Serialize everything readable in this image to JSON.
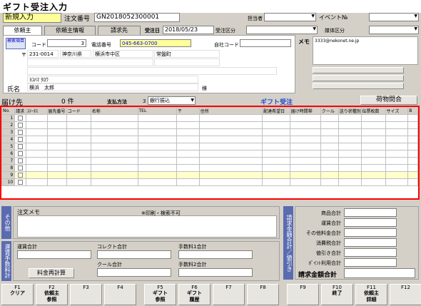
{
  "window": {
    "title": "ギフト受注入力"
  },
  "header": {
    "mode": "新規入力",
    "order_no_label": "注文番号",
    "order_no": "GN2018052300001",
    "staff_label": "担当者",
    "event_label": "イベント№"
  },
  "tabs": [
    "依頼主",
    "依頼主情報",
    "請求先"
  ],
  "order_date_label": "受注日",
  "order_date": "2018/05/23",
  "order_type_label": "受注区分",
  "medium_label": "媒体区分",
  "client": {
    "search_label": "検索項目",
    "code_label": "コード",
    "code": "3",
    "phone_label": "電話番号",
    "phone": "045-663-0700",
    "own_code_label": "自社コード",
    "postal_mark": "〒",
    "postal": "231-0014",
    "pref": "神奈川県",
    "city": "横浜市中区",
    "town": "常盤町",
    "kana": "ﾖｺﾊﾏ ﾀﾛｳ",
    "name_label": "氏名",
    "name": "横浜　太郎",
    "honorific": "様",
    "memo_label": "メモ",
    "email": "3333@nekonet.ne.jp"
  },
  "delivery": {
    "title": "届け先",
    "count": "0 件",
    "payment_label": "支払方法",
    "payment_code": "3",
    "payment": "銀行振込",
    "gift_label": "ギフト受注",
    "inquiry_btn": "荷物問合"
  },
  "grid": {
    "columns": [
      "No.",
      "請求",
      "ｽﾃｰﾀｽ",
      "届先番号",
      "コード",
      "名称",
      "TEL",
      "〒",
      "住所",
      "配達希望日",
      "届け時間帯",
      "クール",
      "送り状種別",
      "伝票枚数",
      "サイズ",
      "B"
    ],
    "rows": [
      "1",
      "2",
      "3",
      "4",
      "5",
      "6",
      "7",
      "8",
      "9",
      "10"
    ]
  },
  "other": {
    "side_label": "その他",
    "memo_label": "注文メモ",
    "memo_note": "※印刷・検索不可"
  },
  "fees": {
    "side_label": "運賃手数料計",
    "shipping_label": "運賃合計",
    "collect_label": "コレクト合計",
    "fee1_label": "手数料1合計",
    "cool_label": "クール合計",
    "fee2_label": "手数料2合計",
    "recalc_btn": "料金再計算"
  },
  "totals": {
    "side_label": "請求金額合計／値引き",
    "items": [
      "商品合計",
      "運賃合計",
      "その他料金合計",
      "消費税合計",
      "値引き合計",
      "ﾎﾟｲﾝﾄ利用合計"
    ],
    "grand_label": "請求金額合計"
  },
  "fkeys": [
    {
      "key": "F1",
      "label": "クリア"
    },
    {
      "key": "F2",
      "label": "依頼主\n参照"
    },
    {
      "key": "F3",
      "label": ""
    },
    {
      "key": "F4",
      "label": ""
    },
    {
      "key": "F5",
      "label": "ギフト\n参照"
    },
    {
      "key": "F6",
      "label": "ギフト\n履歴"
    },
    {
      "key": "F7",
      "label": ""
    },
    {
      "key": "F8",
      "label": ""
    },
    {
      "key": "F9",
      "label": ""
    },
    {
      "key": "F10",
      "label": "終了"
    },
    {
      "key": "F11",
      "label": "依頼主\n詳細"
    },
    {
      "key": "F12",
      "label": ""
    }
  ]
}
